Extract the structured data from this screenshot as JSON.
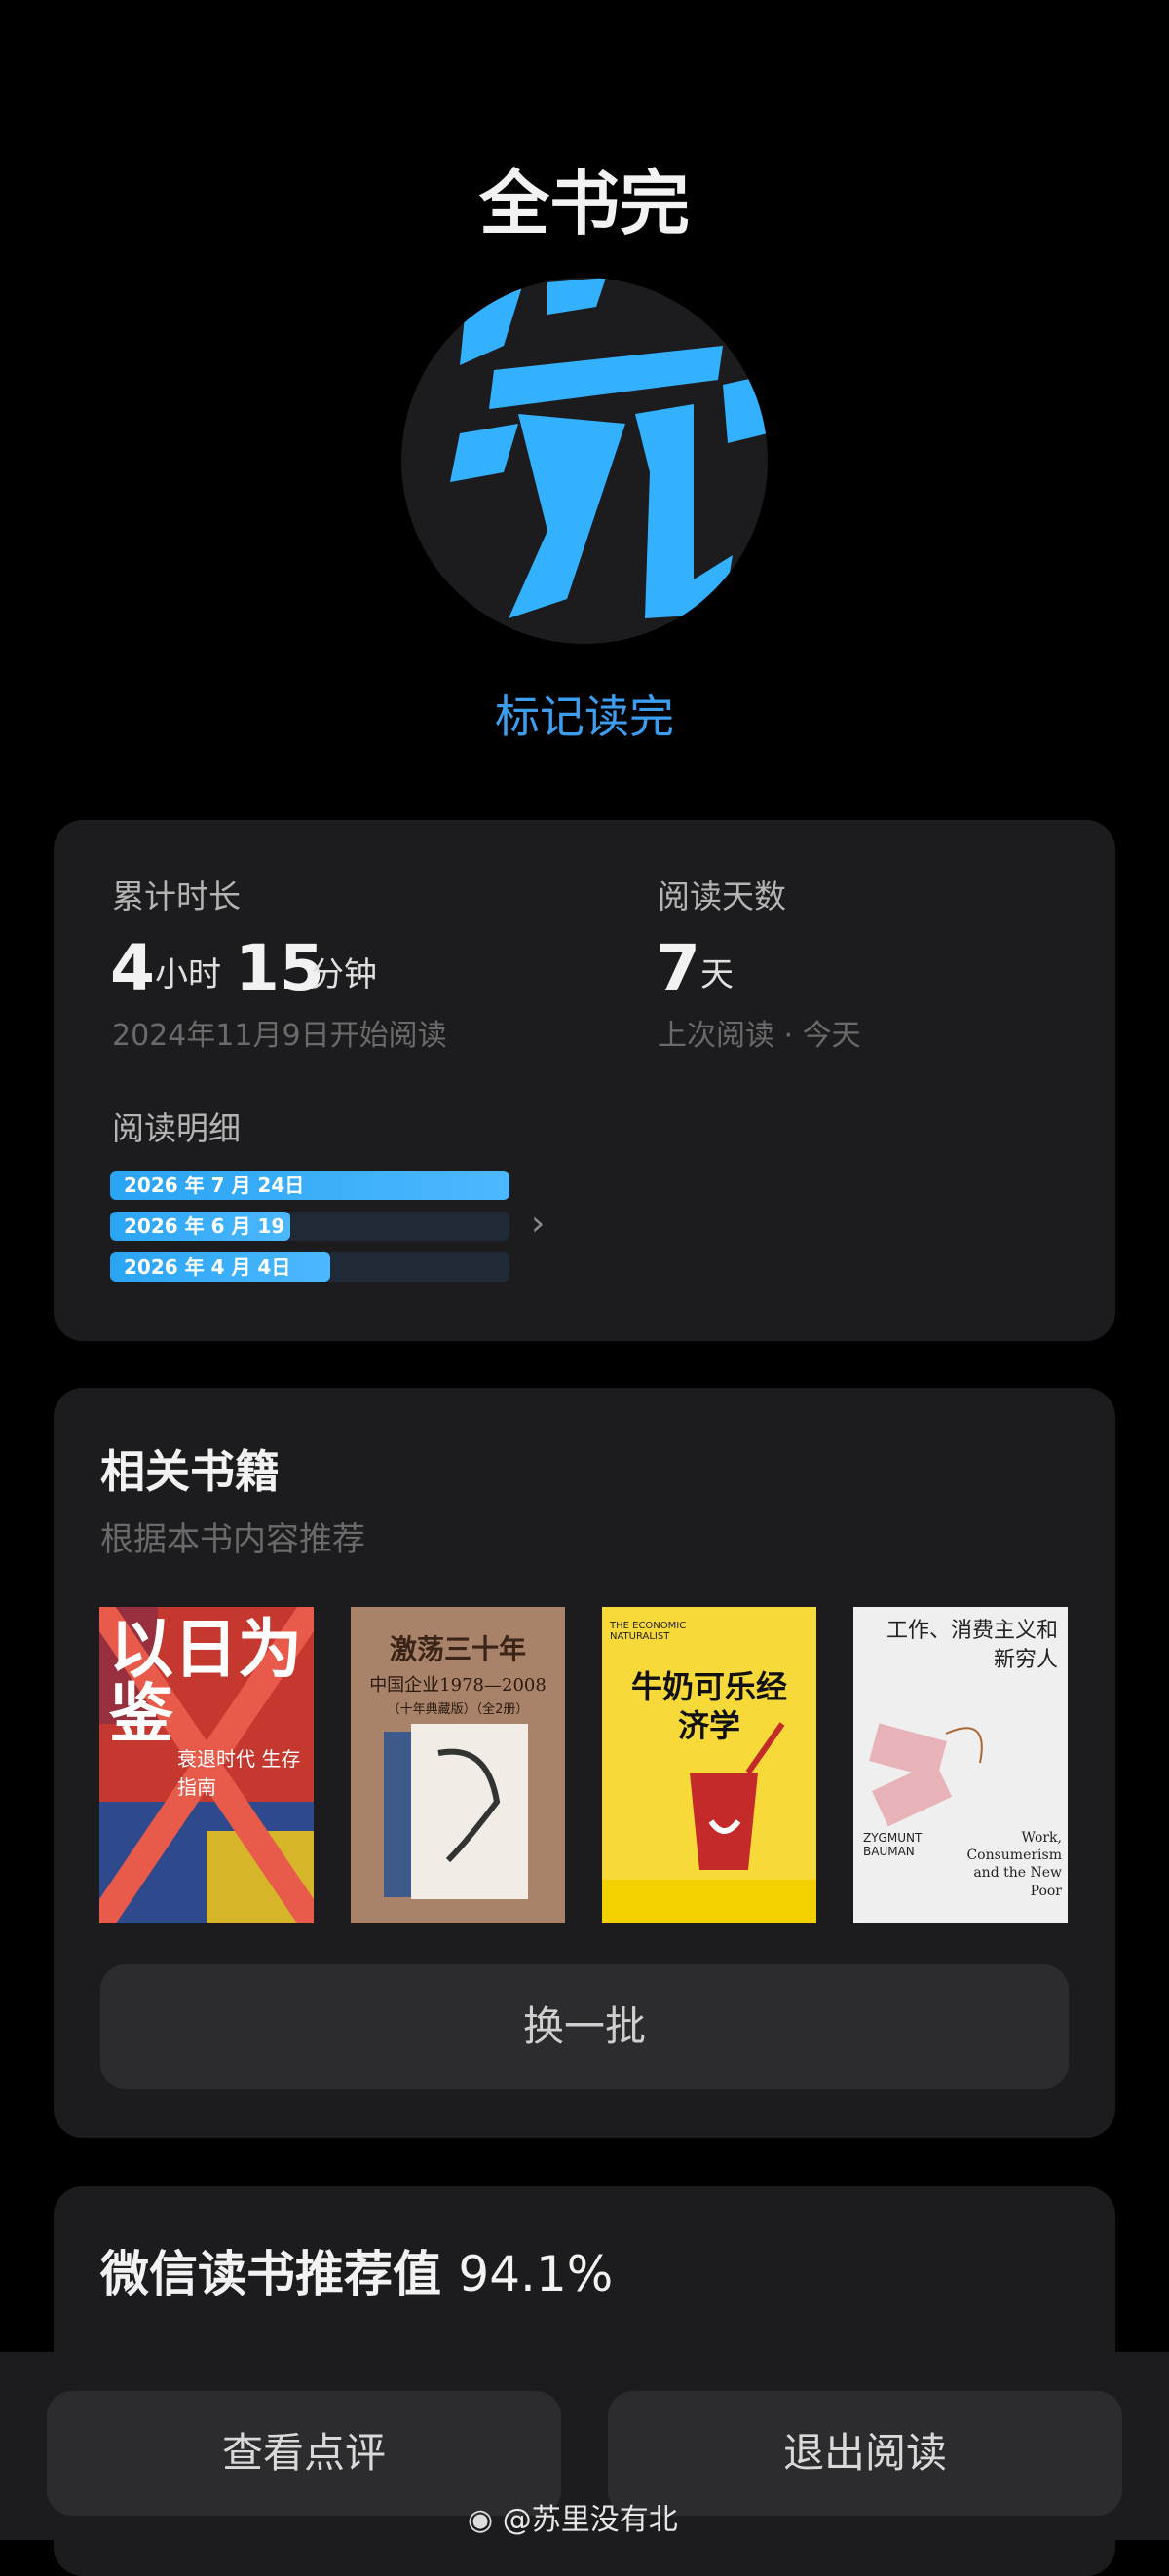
{
  "header": {
    "title": "全书完",
    "badge_glyph": "完",
    "mark_read_label": "标记读完"
  },
  "stats": {
    "duration_label": "累计时长",
    "hours": "4",
    "hours_unit": "小时",
    "minutes": "15",
    "minutes_unit": "分钟",
    "start_text": "2024年11月9日开始阅读",
    "days_label": "阅读天数",
    "days": "7",
    "days_unit": "天",
    "last_read_text": "上次阅读 · 今天",
    "detail_label": "阅读明细",
    "detail_rows": [
      {
        "label": "2026 年 7 月 24日",
        "progress": 1.0
      },
      {
        "label": "2026 年 6 月 19",
        "progress": 0.45
      },
      {
        "label": "2026 年 4 月 4日",
        "progress": 0.55
      }
    ]
  },
  "related": {
    "title": "相关书籍",
    "subtitle": "根据本书内容推荐",
    "books": [
      {
        "cover_text": "以日为鉴",
        "sub": "衰退时代 生存指南",
        "colors": [
          "#c4382f",
          "#2e4a8c",
          "#d6b52b"
        ]
      },
      {
        "cover_text": "激荡三十年",
        "sub": "中国企业1978—2008",
        "edition": "（十年典藏版）（全2册）",
        "colors": [
          "#a9826a"
        ]
      },
      {
        "cover_text": "牛奶可乐经济学",
        "sub": "THE ECONOMIC NATURALIST",
        "colors": [
          "#f7d93a"
        ]
      },
      {
        "cover_text": "工作、消费主义和新穷人",
        "author": "ZYGMUNT BAUMAN",
        "en_title": "Work, Consumerism and the New Poor",
        "colors": [
          "#efefef"
        ]
      }
    ],
    "swap_label": "换一批"
  },
  "rating": {
    "label": "微信读书推荐值",
    "value": "94.1%"
  },
  "footer": {
    "reviews_label": "查看点评",
    "exit_label": "退出阅读",
    "watermark": "@苏里没有北"
  },
  "colors": {
    "accent": "#3d9ef0",
    "card": "#1c1c1e",
    "bar_fill": "#2aa4f4"
  }
}
